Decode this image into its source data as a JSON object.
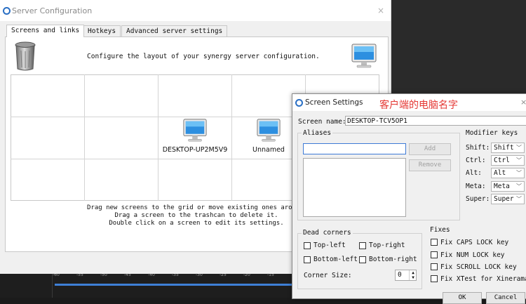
{
  "server_window": {
    "title": "Server Configuration",
    "close_glyph": "×",
    "tabs": [
      {
        "label": "Screens and links",
        "active": true
      },
      {
        "label": "Hotkeys",
        "active": false
      },
      {
        "label": "Advanced server settings",
        "active": false
      }
    ],
    "description": "Configure the layout of your synergy server configuration.",
    "screens": [
      {
        "name": "DESKTOP-UP2M5V9"
      },
      {
        "name": "Unnamed"
      }
    ],
    "help_lines": [
      "Drag new screens to the grid or move existing ones arou",
      "Drag a screen to the trashcan to delete it.",
      "Double click on a screen to edit its settings."
    ]
  },
  "screen_settings": {
    "title": "Screen Settings",
    "annotation": "客户端的电脑名字",
    "annotation_color": "#e53935",
    "screen_name_label": "Screen name:",
    "screen_name_value": "DESKTOP-TCV5OP1",
    "aliases": {
      "title": "Aliases",
      "input_value": "",
      "add_label": "Add",
      "remove_label": "Remove"
    },
    "modifier_keys": {
      "title": "Modifier keys",
      "rows": [
        {
          "label": "Shift:",
          "value": "Shift"
        },
        {
          "label": "Ctrl:",
          "value": "Ctrl"
        },
        {
          "label": "Alt:",
          "value": "Alt"
        },
        {
          "label": "Meta:",
          "value": "Meta"
        },
        {
          "label": "Super:",
          "value": "Super"
        }
      ]
    },
    "dead_corners": {
      "title": "Dead corners",
      "top_left": "Top-left",
      "top_right": "Top-right",
      "bottom_left": "Bottom-left",
      "bottom_right": "Bottom-right",
      "corner_size_label": "Corner Size:",
      "corner_size_value": "0"
    },
    "fixes": {
      "title": "Fixes",
      "items": [
        "Fix CAPS LOCK key",
        "Fix NUM LOCK key",
        "Fix SCROLL LOCK key",
        "Fix XTest for Xinerama"
      ]
    },
    "ok_label": "OK",
    "cancel_label": "Cancel",
    "close_glyph": "×"
  },
  "timeline": {
    "ticks": [
      "-60",
      "-55",
      "-50",
      "-45",
      "-40",
      "-35",
      "-30",
      "-25",
      "-20",
      "-15"
    ]
  },
  "colors": {
    "accent": "#3d7ad6",
    "app_icon": "#2a6fc4",
    "timeline_bar": "#3e7fd6"
  },
  "icons": {
    "app": "synergy-icon",
    "trash": "trashcan-icon",
    "monitor": "monitor-icon"
  }
}
